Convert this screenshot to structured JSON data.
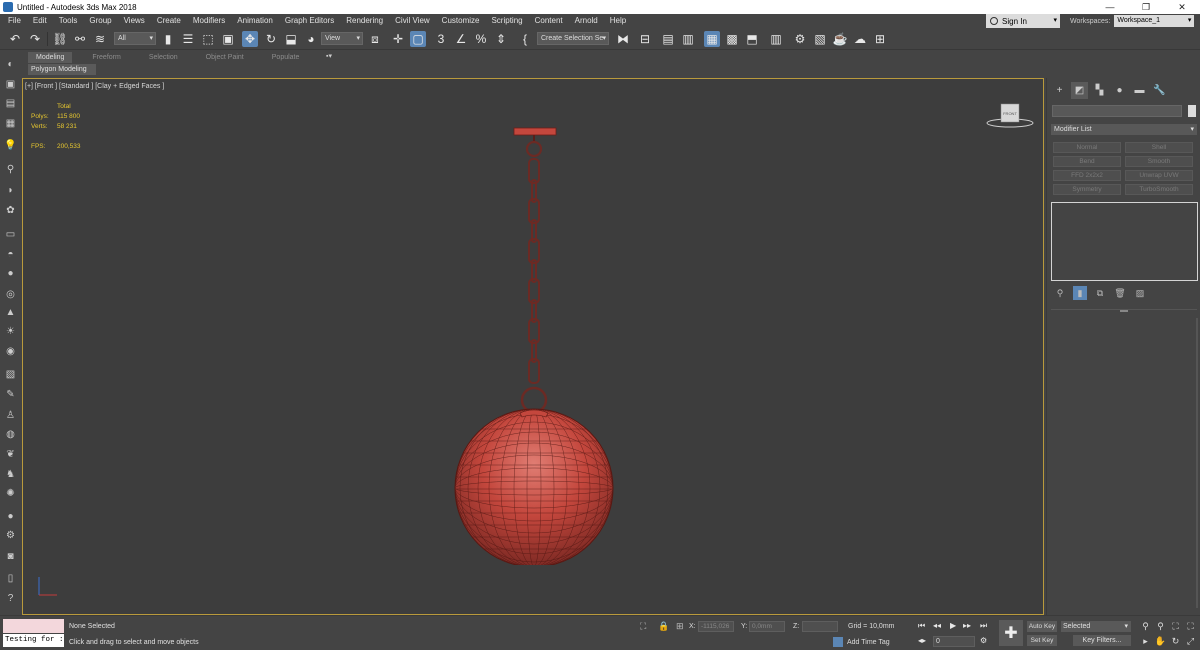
{
  "window": {
    "title": "Untitled - Autodesk 3ds Max 2018",
    "minimize": "—",
    "maximize": "❐",
    "close": "✕"
  },
  "menu": [
    "File",
    "Edit",
    "Tools",
    "Group",
    "Views",
    "Create",
    "Modifiers",
    "Animation",
    "Graph Editors",
    "Rendering",
    "Civil View",
    "Customize",
    "Scripting",
    "Content",
    "Arnold",
    "Help"
  ],
  "account": {
    "sign_in": "Sign In",
    "workspaces_label": "Workspaces:",
    "workspace": "Workspace_1"
  },
  "toolbar": {
    "selection_filter": "All",
    "ref_coord": "View",
    "named_selection": "Create Selection Se"
  },
  "ribbon": {
    "tabs": [
      "Modeling",
      "Freeform",
      "Selection",
      "Object Paint",
      "Populate"
    ],
    "active_tab": "Modeling",
    "sub_label": "Polygon Modeling",
    "extra": "▪▾"
  },
  "viewport": {
    "label": "[+] [Front ] [Standard ] [Clay + Edged Faces ]",
    "stats": {
      "total_label": "Total",
      "polys_label": "Polys:",
      "polys": "115 800",
      "verts_label": "Verts:",
      "verts": "58 231",
      "fps_label": "FPS:",
      "fps": "200,533"
    },
    "viewcube_label": "FRONT",
    "wire_color": "#c4473d"
  },
  "command_panel": {
    "modifier_list": "Modifier List",
    "modifier_buttons": [
      "Normal",
      "Shell",
      "Bend",
      "Smooth",
      "FFD 2x2x2",
      "Unwrap UVW",
      "Symmetry",
      "TurboSmooth"
    ]
  },
  "status": {
    "maxscript_input": "Testing for :",
    "selection": "None Selected",
    "prompt": "Click and drag to select and move objects",
    "x_label": "X:",
    "x_value": "-1115,026",
    "y_label": "Y:",
    "y_value": "0,0mm",
    "z_label": "Z:",
    "z_value": "",
    "grid": "Grid = 10,0mm",
    "add_time_tag": "Add Time Tag",
    "frame": "0",
    "auto_key": "Auto Key",
    "set_key": "Set Key",
    "selected": "Selected",
    "key_filters": "Key Filters..."
  }
}
